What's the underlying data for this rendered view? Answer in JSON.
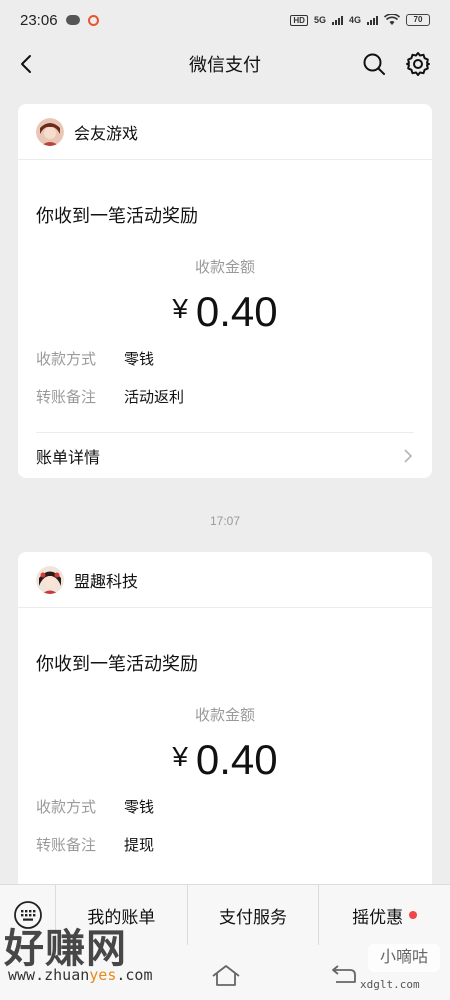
{
  "status_bar": {
    "time": "23:06",
    "hd": "HD",
    "network": "5G",
    "network2": "4G",
    "battery": "70"
  },
  "nav": {
    "title": "微信支付",
    "icons": [
      "back-arrow-icon",
      "search-icon",
      "gear-icon"
    ]
  },
  "cards": [
    {
      "merchant": "会友游戏",
      "notice": "你收到一笔活动奖励",
      "amount_label": "收款金额",
      "currency": "¥",
      "amount": "0.40",
      "rows": [
        {
          "key": "收款方式",
          "value": "零钱"
        },
        {
          "key": "转账备注",
          "value": "活动返利"
        }
      ],
      "detail_label": "账单详情"
    },
    {
      "merchant": "盟趣科技",
      "notice": "你收到一笔活动奖励",
      "amount_label": "收款金额",
      "currency": "¥",
      "amount": "0.40",
      "rows": [
        {
          "key": "收款方式",
          "value": "零钱"
        },
        {
          "key": "转账备注",
          "value": "提现"
        }
      ]
    }
  ],
  "timestamp": "17:07",
  "bottom_menu": {
    "items": [
      "我的账单",
      "支付服务",
      "摇优惠"
    ]
  },
  "watermarks": {
    "main": "好赚网",
    "url_a": "www.zhuan",
    "url_hl": "yes",
    "url_b": ".com",
    "right": "小嘀咕",
    "right_url": "xdglt.com"
  },
  "colors": {
    "page_bg": "#ededed",
    "card_bg": "#ffffff",
    "muted_text": "#9a9a9a",
    "red_dot": "#f04848",
    "status_ring": "#e8542f"
  }
}
